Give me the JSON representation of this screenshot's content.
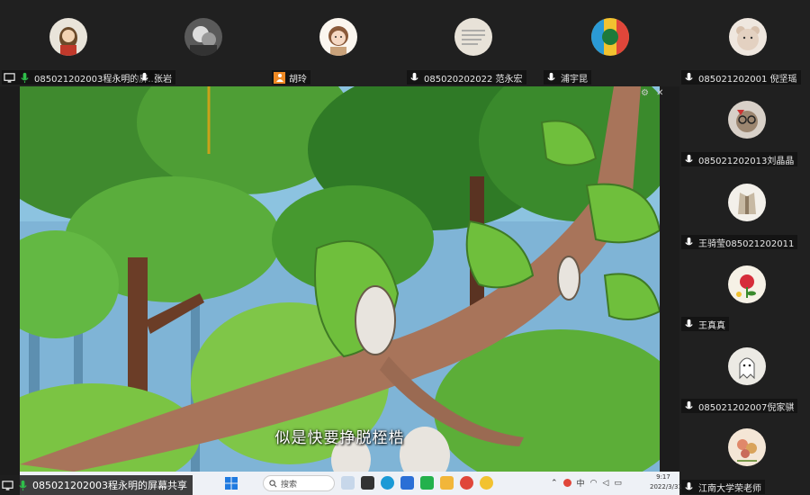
{
  "top_participants": [
    {
      "name": "085021202003程永明的屏...",
      "mic": "screen",
      "avatar": "avatar-doll"
    },
    {
      "name": "张岩",
      "mic": "muted",
      "avatar": "avatar-bw-portrait"
    },
    {
      "name": "胡玲",
      "mic": "person",
      "avatar": "avatar-cartoon-girl"
    },
    {
      "name": "085020202022 范永宏",
      "mic": "muted",
      "avatar": "avatar-text-card"
    },
    {
      "name": "浦宇昆",
      "mic": "muted",
      "avatar": "avatar-colorful-art"
    },
    {
      "name": "085021202001 倪坚瑶",
      "mic": "muted",
      "avatar": "avatar-teddy-bear"
    }
  ],
  "right_participants": [
    {
      "name": "085021202013刘晶晶",
      "mic": "muted",
      "avatar": "avatar-cat-glasses"
    },
    {
      "name": "王骑莹085021202011",
      "mic": "muted",
      "avatar": "avatar-clothes"
    },
    {
      "name": "王真真",
      "mic": "muted",
      "avatar": "avatar-rose"
    },
    {
      "name": "085021202007倪家骐",
      "mic": "muted",
      "avatar": "avatar-ghost"
    },
    {
      "name": "江南大学荣老师",
      "mic": "muted",
      "avatar": "avatar-flowers"
    }
  ],
  "share": {
    "subtitle": "似是快要挣脱桎梏"
  },
  "taskbar": {
    "search_placeholder": "搜索",
    "ime": "中",
    "time": "9:17",
    "date": "2022/3/31"
  },
  "owner_label": "085021202003程永明的屏幕共享",
  "colors": {
    "accent_orange": "#f08a24",
    "mic_green": "#2fbf4a",
    "mic_muted": "#e53935"
  }
}
